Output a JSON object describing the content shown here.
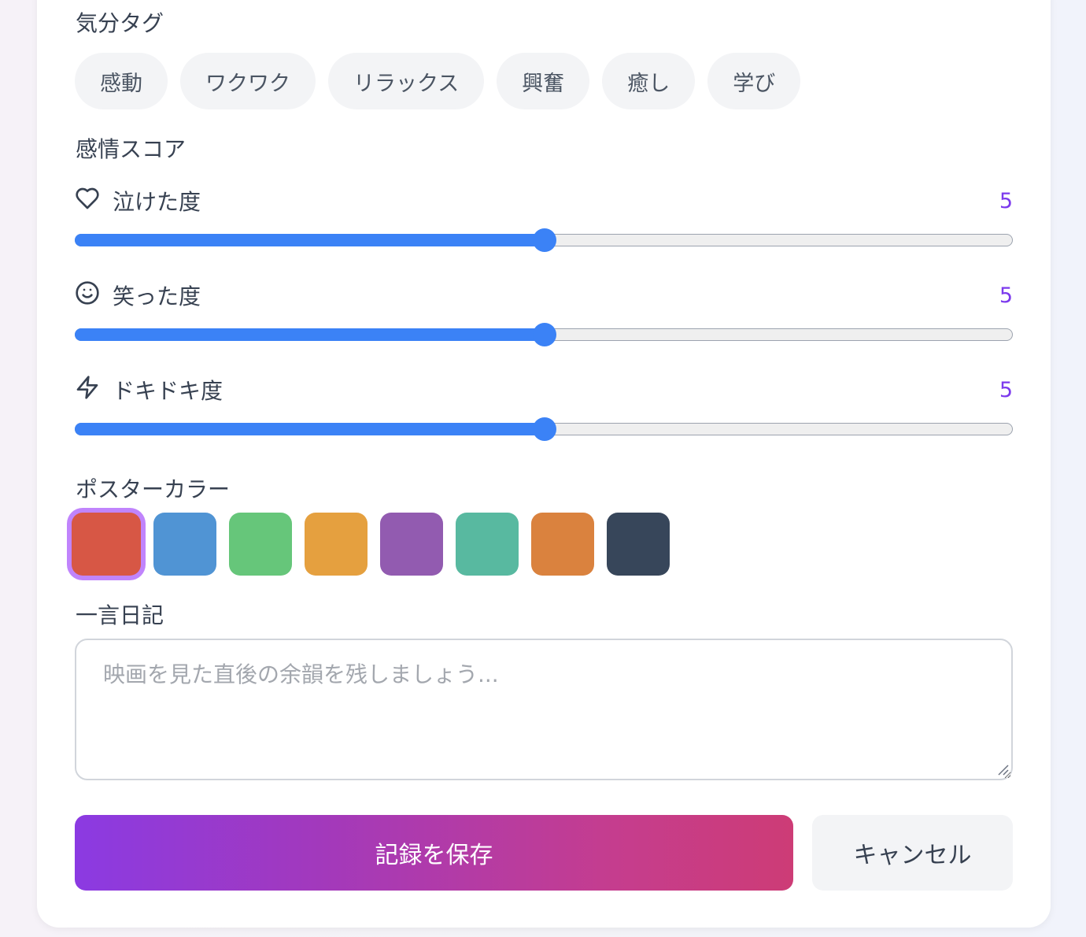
{
  "mood_tags": {
    "label": "気分タグ",
    "tags": [
      "感動",
      "ワクワク",
      "リラックス",
      "興奮",
      "癒し",
      "学び"
    ]
  },
  "emotion_score": {
    "label": "感情スコア",
    "max": 10,
    "sliders": [
      {
        "label": "泣けた度",
        "value": "5",
        "icon": "heart-icon",
        "level": 0.5
      },
      {
        "label": "笑った度",
        "value": "5",
        "icon": "smile-icon",
        "level": 0.5
      },
      {
        "label": "ドキドキ度",
        "value": "5",
        "icon": "zap-icon",
        "level": 0.5
      }
    ]
  },
  "poster_color": {
    "label": "ポスターカラー",
    "selected_index": 0,
    "colors": [
      "#d75745",
      "#5094d4",
      "#66c67a",
      "#e5a03f",
      "#925bb0",
      "#58b9a0",
      "#da823e",
      "#37465a"
    ]
  },
  "diary": {
    "label": "一言日記",
    "placeholder": "映画を見た直後の余韻を残しましょう..."
  },
  "actions": {
    "save": "記録を保存",
    "cancel": "キャンセル"
  },
  "colors": {
    "accent": "#3b82f6",
    "value_text": "#7c3aed",
    "gradient_start": "#8b3ae2",
    "gradient_end": "#cd3c76"
  }
}
